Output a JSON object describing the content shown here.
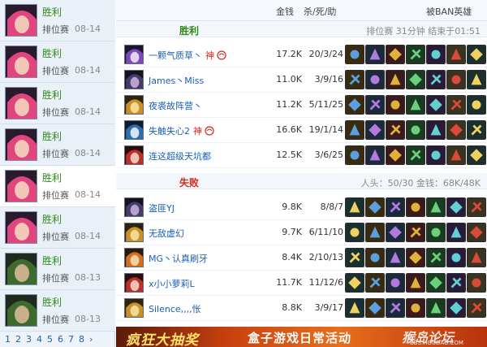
{
  "colors": {
    "win": "#2e8b18",
    "lose": "#d22a1e",
    "link": "#1a5fb4"
  },
  "sidebar": {
    "matches": [
      {
        "result": "胜利",
        "mode": "排位赛",
        "date": "08-14",
        "avatar_icon": "pink-hair-champion-icon",
        "selected": false
      },
      {
        "result": "胜利",
        "mode": "排位赛",
        "date": "08-14",
        "avatar_icon": "pink-hair-champion-icon",
        "selected": false
      },
      {
        "result": "胜利",
        "mode": "排位赛",
        "date": "08-14",
        "avatar_icon": "pink-hair-champion-icon",
        "selected": false
      },
      {
        "result": "胜利",
        "mode": "排位赛",
        "date": "08-14",
        "avatar_icon": "pink-hair-champion-icon",
        "selected": false
      },
      {
        "result": "胜利",
        "mode": "排位赛",
        "date": "08-14",
        "avatar_icon": "pink-hair-champion-icon",
        "selected": true
      },
      {
        "result": "胜利",
        "mode": "排位赛",
        "date": "08-14",
        "avatar_icon": "pink-hair-champion-icon",
        "selected": false
      },
      {
        "result": "胜利",
        "mode": "排位赛",
        "date": "08-13",
        "avatar_icon": "green-hood-champion-icon",
        "selected": false
      },
      {
        "result": "胜利",
        "mode": "排位赛",
        "date": "08-13",
        "avatar_icon": "green-hood-champion-icon",
        "selected": false
      }
    ],
    "pages": [
      "1",
      "2",
      "3",
      "4",
      "5",
      "6",
      "7",
      "8",
      "›"
    ]
  },
  "header": {
    "gold": "金钱",
    "kda": "杀/死/助",
    "banned": "被BAN英雄"
  },
  "win_section": {
    "label": "胜利",
    "info": "排位赛  31分钟  结束于01:51",
    "players": [
      {
        "name": "一颗气质草丶",
        "badges": [
          "神"
        ],
        "gold": "17.2K",
        "kda": "20/3/24",
        "champ_icon": "purple-champion-icon"
      },
      {
        "name": "James丶Miss",
        "badges": [],
        "gold": "11.0K",
        "kda": "3/9/16",
        "champ_icon": "dark-champion-icon"
      },
      {
        "name": "夜裘故阵营丶",
        "badges": [],
        "gold": "11.2K",
        "kda": "5/11/25",
        "champ_icon": "gold-champion-icon"
      },
      {
        "name": "失触失心2",
        "badges": [
          "神"
        ],
        "gold": "16.6K",
        "kda": "19/1/14",
        "champ_icon": "blue-champion-icon"
      },
      {
        "name": "连这超级天坑都",
        "badges": [],
        "gold": "12.5K",
        "kda": "3/6/25",
        "champ_icon": "red-champion-icon"
      }
    ]
  },
  "lose_section": {
    "label": "失败",
    "info": "人头：50/30  金钱：68K/48K",
    "players": [
      {
        "name": "盗匪YJ",
        "badges": [],
        "gold": "9.8K",
        "kda": "8/8/7",
        "champ_icon": "dark-champion-icon"
      },
      {
        "name": "无敌虚幻",
        "badges": [],
        "gold": "9.7K",
        "kda": "6/11/10",
        "champ_icon": "gold-champion-icon"
      },
      {
        "name": "MG丶认真刷牙",
        "badges": [],
        "gold": "8.4K",
        "kda": "2/10/13",
        "champ_icon": "orange-champion-icon"
      },
      {
        "name": "x小小萝莉L",
        "badges": [],
        "gold": "11.7K",
        "kda": "11/12/6",
        "champ_icon": "red-champion-icon"
      },
      {
        "name": "Silence,,,,怅",
        "badges": [],
        "gold": "8.8K",
        "kda": "3/9/17",
        "champ_icon": "gold-champion-icon"
      }
    ]
  },
  "banner": {
    "text1": "疯狂大抽奖",
    "text2": "盒子游戏日常活动",
    "watermark": "猴岛论坛",
    "watermark_sub": "BBS.HOUDAO.COM"
  }
}
